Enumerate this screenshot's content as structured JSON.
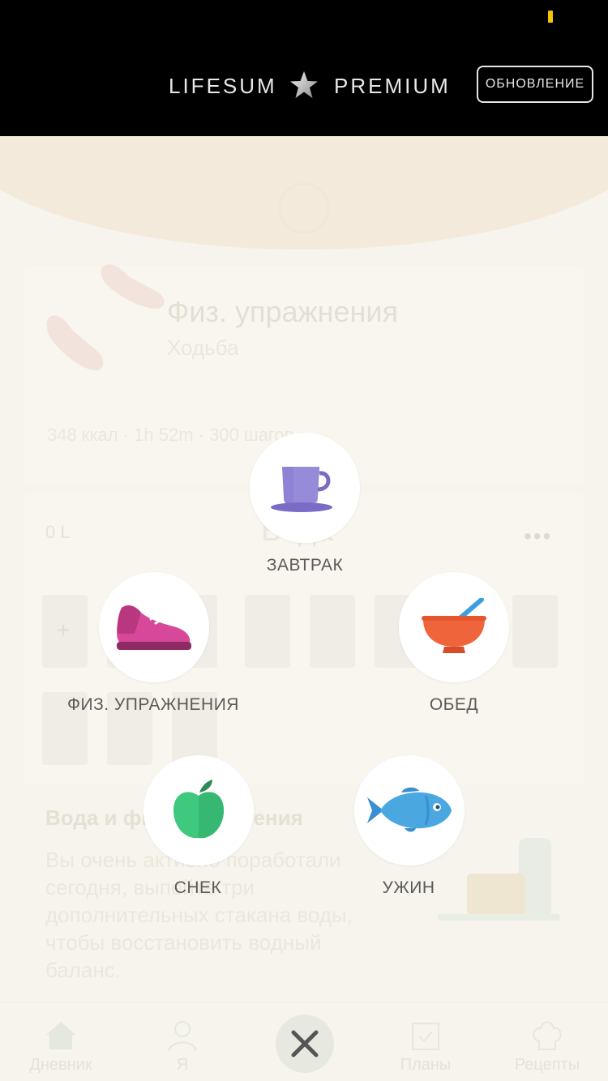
{
  "banner": {
    "brand_left": "LIFESUM",
    "brand_right": "PREMIUM",
    "upgrade_label": "ОБНОВЛЕНИЕ",
    "battery_color": "#f5c400"
  },
  "background": {
    "exercise_card": {
      "title": "Физ. упражнения",
      "subtitle": "Ходьба",
      "stats": "348 ккал · 1h 52m · 300 шагов"
    },
    "water_card": {
      "amount": "0 L",
      "title": "Вода",
      "more": "•••",
      "add": "+"
    },
    "tip": {
      "title": "Вода и физ. упражнения",
      "text": "Вы очень активно поработали сегодня, выпейте три дополнительных стакана воды, чтобы восстановить водный баланс."
    },
    "nav": [
      {
        "label": "Дневник",
        "icon": "home-icon"
      },
      {
        "label": "Я",
        "icon": "person-icon"
      },
      {
        "label": "Планы",
        "icon": "calendar-check-icon"
      },
      {
        "label": "Рецепты",
        "icon": "chef-hat-icon"
      }
    ]
  },
  "menu": {
    "breakfast": {
      "label": "ЗАВТРАК",
      "icon": "coffee-cup-icon",
      "color": "#8e82d4"
    },
    "exercise": {
      "label": "ФИЗ. УПРАЖНЕНИЯ",
      "icon": "sneaker-icon",
      "color": "#d8489a"
    },
    "lunch": {
      "label": "ОБЕД",
      "icon": "bowl-icon",
      "color": "#f0643c"
    },
    "snack": {
      "label": "СНЕК",
      "icon": "apple-icon",
      "color": "#3ec97f"
    },
    "dinner": {
      "label": "УЖИН",
      "icon": "fish-icon",
      "color": "#4aa7e0"
    }
  },
  "close_icon": "close-icon"
}
